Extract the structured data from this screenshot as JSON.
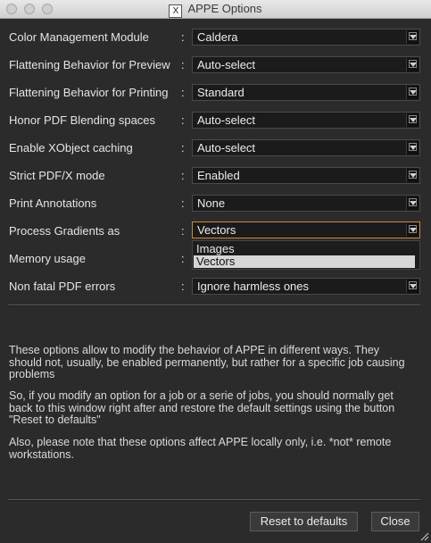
{
  "window": {
    "title": "APPE Options",
    "title_icon": "X"
  },
  "options": [
    {
      "label": "Color Management Module",
      "value": "Caldera"
    },
    {
      "label": "Flattening Behavior for Preview",
      "value": "Auto-select"
    },
    {
      "label": "Flattening Behavior for Printing",
      "value": "Standard"
    },
    {
      "label": "Honor PDF Blending spaces",
      "value": "Auto-select"
    },
    {
      "label": "Enable XObject caching",
      "value": "Auto-select"
    },
    {
      "label": "Strict PDF/X mode",
      "value": "Enabled"
    },
    {
      "label": "Print Annotations",
      "value": "None"
    },
    {
      "label": "Process Gradients as",
      "value": "Vectors"
    },
    {
      "label": "Memory usage",
      "value": ""
    },
    {
      "label": "Non fatal PDF errors",
      "value": "Ignore harmless ones"
    }
  ],
  "separator": ":",
  "dropdown": {
    "options": [
      "Images",
      "Vectors"
    ],
    "selected": "Vectors"
  },
  "info": {
    "p1": "These options allow to modify the behavior of APPE in different ways. They should not, usually, be enabled permanently, but rather for a specific job causing problems",
    "p2": "So, if you modify an option for a job or a serie of jobs, you should normally get back to this window right after and restore the default settings using the button \"Reset to defaults\"",
    "p3": "Also, please note that these options affect APPE locally only, i.e. *not* remote workstations."
  },
  "buttons": {
    "reset": "Reset to defaults",
    "close": "Close"
  },
  "colors": {
    "background": "#2b2b2b",
    "focus_border": "#c98c36",
    "titlebar": "#dcdcdc"
  }
}
